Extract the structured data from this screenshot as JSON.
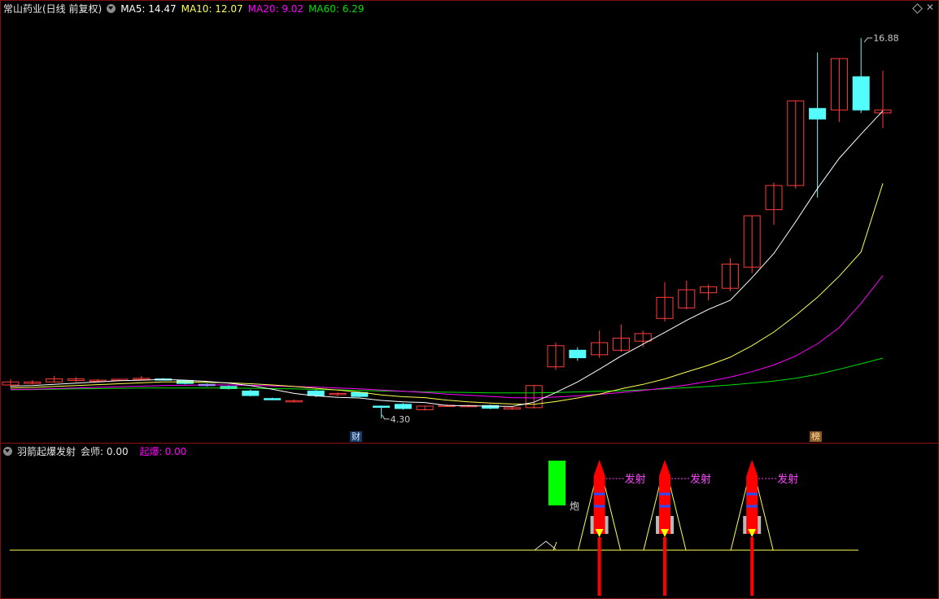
{
  "main_header": {
    "title": "常山药业(日线 前复权)",
    "ma5": "MA5: 14.47",
    "ma10": "MA10: 12.07",
    "ma20": "MA20: 9.02",
    "ma60": "MA60: 6.29"
  },
  "sub_header": {
    "title": "羽箭起爆发射",
    "field1": "会师: 0.00",
    "field2_label": "起爆:",
    "field2_value": "0.00"
  },
  "annotations": {
    "high": "16.88",
    "low": "4.30",
    "marker_cai": "财",
    "marker_bang": "榜",
    "launch_label": "发射",
    "cannon_label": "炮"
  },
  "colors": {
    "up": "#ff3b3b",
    "down": "#54fcfc",
    "ma5": "#ffffff",
    "ma10": "#ffff50",
    "ma20": "#ff00ff",
    "ma60": "#00e000",
    "sub_line": "#ffff50",
    "rocket": "#ff0000",
    "signal_green": "#00ff00"
  },
  "chart_data": {
    "type": "candlestick",
    "price_ylim": [
      4.0,
      17.6
    ],
    "candles": [
      [
        5.4,
        5.5,
        5.3,
        5.6
      ],
      [
        5.45,
        5.5,
        5.42,
        5.56
      ],
      [
        5.5,
        5.6,
        5.48,
        5.7
      ],
      [
        5.55,
        5.6,
        5.5,
        5.66
      ],
      [
        5.55,
        5.56,
        5.52,
        5.6
      ],
      [
        5.57,
        5.59,
        5.55,
        5.6
      ],
      [
        5.58,
        5.62,
        5.55,
        5.7
      ],
      [
        5.6,
        5.58,
        5.55,
        5.63
      ],
      [
        5.55,
        5.45,
        5.42,
        5.56
      ],
      [
        5.42,
        5.38,
        5.35,
        5.45
      ],
      [
        5.35,
        5.28,
        5.25,
        5.38
      ],
      [
        5.2,
        5.05,
        5.02,
        5.25
      ],
      [
        4.95,
        4.92,
        4.9,
        4.98
      ],
      [
        4.85,
        4.88,
        4.82,
        4.92
      ],
      [
        5.2,
        5.05,
        5.0,
        5.25
      ],
      [
        5.08,
        5.12,
        5.03,
        5.15
      ],
      [
        5.15,
        5.02,
        5.0,
        5.18
      ],
      [
        4.7,
        4.68,
        4.3,
        4.72
      ],
      [
        4.76,
        4.62,
        4.58,
        4.8
      ],
      [
        4.58,
        4.7,
        4.55,
        4.72
      ],
      [
        4.72,
        4.73,
        4.7,
        4.76
      ],
      [
        4.7,
        4.72,
        4.68,
        4.75
      ],
      [
        4.72,
        4.63,
        4.6,
        4.75
      ],
      [
        4.6,
        4.65,
        4.58,
        4.68
      ],
      [
        4.65,
        5.38,
        4.62,
        5.4
      ],
      [
        6.0,
        6.7,
        5.9,
        6.8
      ],
      [
        6.55,
        6.3,
        6.2,
        6.65
      ],
      [
        6.4,
        6.8,
        6.3,
        7.2
      ],
      [
        6.55,
        6.95,
        6.5,
        7.4
      ],
      [
        6.85,
        7.1,
        6.65,
        7.2
      ],
      [
        7.6,
        8.3,
        7.5,
        8.8
      ],
      [
        7.95,
        8.55,
        7.9,
        8.85
      ],
      [
        8.45,
        8.65,
        8.2,
        8.72
      ],
      [
        8.6,
        9.4,
        8.5,
        9.6
      ],
      [
        9.3,
        11.0,
        9.1,
        11.0
      ],
      [
        11.2,
        12.0,
        10.7,
        12.1
      ],
      [
        12.0,
        14.8,
        11.9,
        14.8
      ],
      [
        14.55,
        14.2,
        11.6,
        16.4
      ],
      [
        14.5,
        16.2,
        14.1,
        16.2
      ],
      [
        15.6,
        14.5,
        14.4,
        16.88
      ],
      [
        14.4,
        14.5,
        13.9,
        15.8
      ]
    ],
    "ma5": [
      5.36,
      5.38,
      5.42,
      5.46,
      5.5,
      5.54,
      5.56,
      5.58,
      5.56,
      5.52,
      5.46,
      5.38,
      5.26,
      5.12,
      5.04,
      4.99,
      4.97,
      4.89,
      4.84,
      4.82,
      4.72,
      4.71,
      4.7,
      4.69,
      4.83,
      5.15,
      5.5,
      5.92,
      6.36,
      6.75,
      7.14,
      7.54,
      7.9,
      8.2,
      8.95,
      9.75,
      10.8,
      11.9,
      12.9,
      13.7,
      14.47
    ],
    "ma10": [
      5.3,
      5.32,
      5.35,
      5.38,
      5.41,
      5.44,
      5.47,
      5.5,
      5.5,
      5.49,
      5.47,
      5.44,
      5.4,
      5.35,
      5.29,
      5.23,
      5.16,
      5.07,
      5.01,
      4.98,
      4.9,
      4.84,
      4.8,
      4.77,
      4.76,
      4.85,
      4.97,
      5.1,
      5.27,
      5.42,
      5.6,
      5.83,
      6.05,
      6.32,
      6.7,
      7.15,
      7.7,
      8.3,
      9.0,
      9.8,
      12.07
    ],
    "ma20": [
      5.25,
      5.26,
      5.28,
      5.3,
      5.32,
      5.34,
      5.36,
      5.38,
      5.39,
      5.4,
      5.4,
      5.39,
      5.37,
      5.35,
      5.33,
      5.3,
      5.27,
      5.23,
      5.19,
      5.15,
      5.1,
      5.06,
      5.02,
      4.98,
      4.97,
      5.0,
      5.04,
      5.09,
      5.15,
      5.22,
      5.3,
      5.4,
      5.52,
      5.66,
      5.84,
      6.06,
      6.36,
      6.76,
      7.3,
      8.1,
      9.02
    ],
    "ma60": [
      5.24,
      5.25,
      5.26,
      5.27,
      5.28,
      5.29,
      5.3,
      5.3,
      5.3,
      5.3,
      5.3,
      5.29,
      5.28,
      5.27,
      5.25,
      5.24,
      5.22,
      5.2,
      5.19,
      5.17,
      5.16,
      5.15,
      5.14,
      5.14,
      5.14,
      5.15,
      5.17,
      5.19,
      5.21,
      5.24,
      5.27,
      5.31,
      5.35,
      5.4,
      5.46,
      5.53,
      5.62,
      5.75,
      5.92,
      6.1,
      6.29
    ],
    "high_marker": 16.88,
    "low_marker": 4.3,
    "sub_signals": {
      "cannon_index": 25,
      "launch_indices": [
        27,
        30,
        34
      ]
    }
  }
}
